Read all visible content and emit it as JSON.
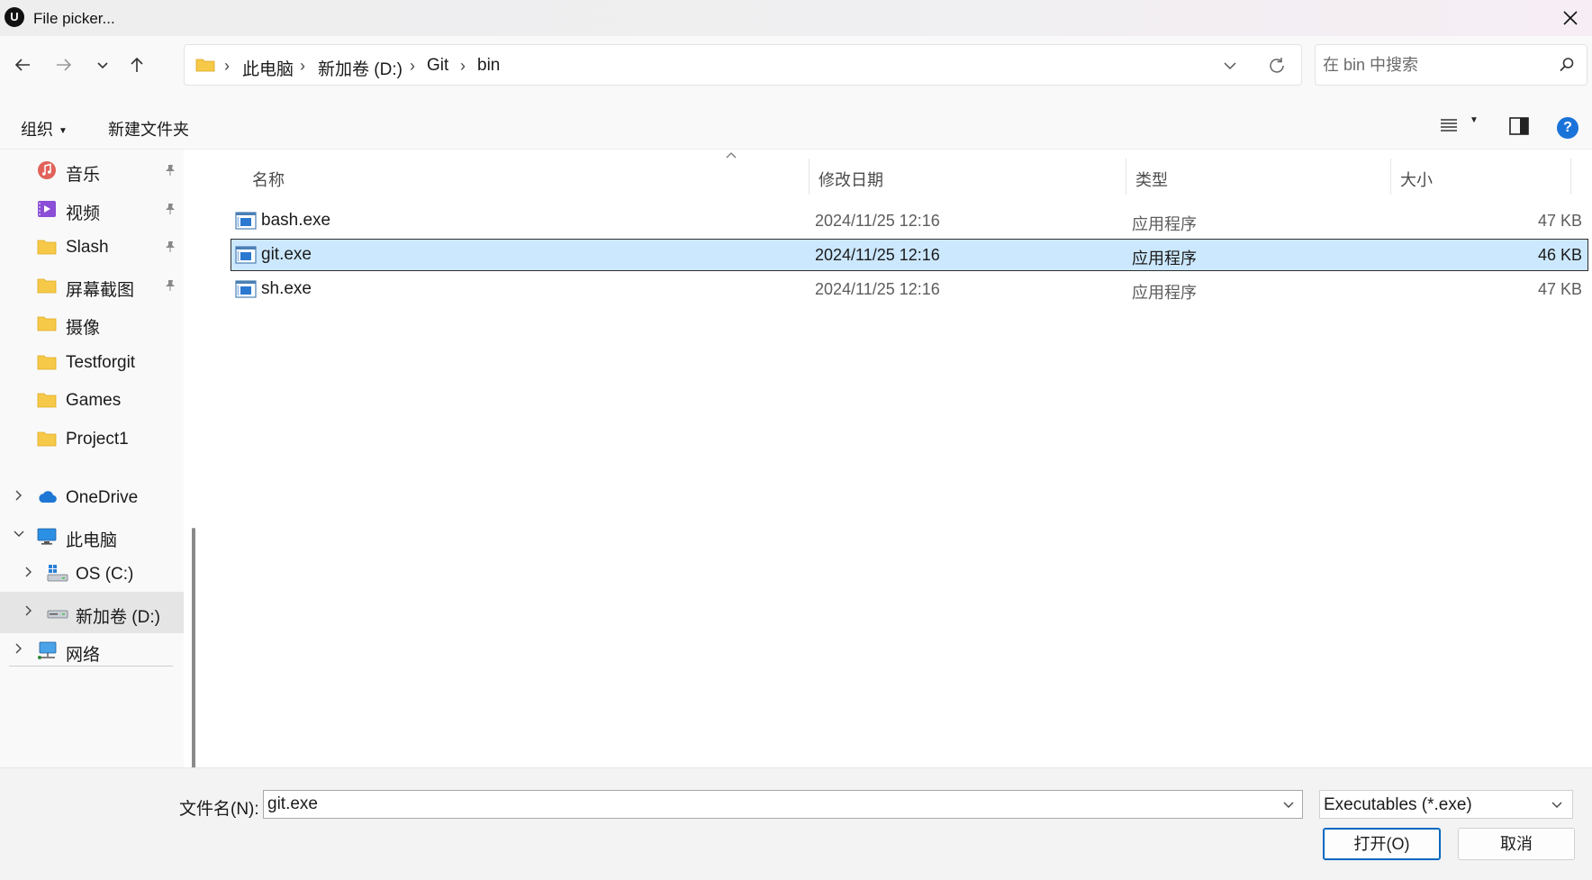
{
  "window": {
    "title": "File picker...",
    "logo_text": "U"
  },
  "nav_buttons": {
    "back": "back-arrow-icon",
    "forward": "forward-arrow-icon",
    "recent": "chevron-down-icon",
    "up": "up-arrow-icon"
  },
  "address": {
    "crumbs": [
      "此电脑",
      "新加卷 (D:)",
      "Git",
      "bin"
    ],
    "separator": "›"
  },
  "search": {
    "placeholder": "在 bin 中搜索"
  },
  "toolbar": {
    "organize_label": "组织",
    "new_folder_label": "新建文件夹",
    "help_label": "?"
  },
  "sidebar": {
    "quick_access": [
      {
        "label": "音乐",
        "icon": "music-icon",
        "pinned": true
      },
      {
        "label": "视频",
        "icon": "video-icon",
        "pinned": true
      },
      {
        "label": "Slash",
        "icon": "folder-icon",
        "pinned": true
      },
      {
        "label": "屏幕截图",
        "icon": "folder-icon",
        "pinned": true
      },
      {
        "label": "摄像",
        "icon": "folder-icon",
        "pinned": false
      },
      {
        "label": "Testforgit",
        "icon": "folder-icon",
        "pinned": false
      },
      {
        "label": "Games",
        "icon": "folder-icon",
        "pinned": false
      },
      {
        "label": "Project1",
        "icon": "folder-icon",
        "pinned": false
      }
    ],
    "tree": [
      {
        "label": "OneDrive",
        "icon": "cloud-icon",
        "expanded": false
      },
      {
        "label": "此电脑",
        "icon": "computer-icon",
        "expanded": true
      },
      {
        "label": "OS (C:)",
        "icon": "windows-drive-icon",
        "expanded": false
      },
      {
        "label": "新加卷 (D:)",
        "icon": "drive-icon",
        "expanded": false,
        "selected": true
      },
      {
        "label": "网络",
        "icon": "network-icon",
        "expanded": false
      }
    ]
  },
  "columns": {
    "name": "名称",
    "date": "修改日期",
    "type": "类型",
    "size": "大小"
  },
  "files": [
    {
      "name": "bash.exe",
      "date": "2024/11/25 12:16",
      "type": "应用程序",
      "size": "47 KB",
      "selected": false
    },
    {
      "name": "git.exe",
      "date": "2024/11/25 12:16",
      "type": "应用程序",
      "size": "46 KB",
      "selected": true
    },
    {
      "name": "sh.exe",
      "date": "2024/11/25 12:16",
      "type": "应用程序",
      "size": "47 KB",
      "selected": false
    }
  ],
  "footer": {
    "filename_label": "文件名(N):",
    "filename_value": "git.exe",
    "filetype_value": "Executables (*.exe)",
    "open_label": "打开(O)",
    "cancel_label": "取消"
  },
  "colors": {
    "accent": "#0067c0",
    "selection": "#cce8ff",
    "folder": "#f7c948",
    "help": "#1a73d9"
  }
}
